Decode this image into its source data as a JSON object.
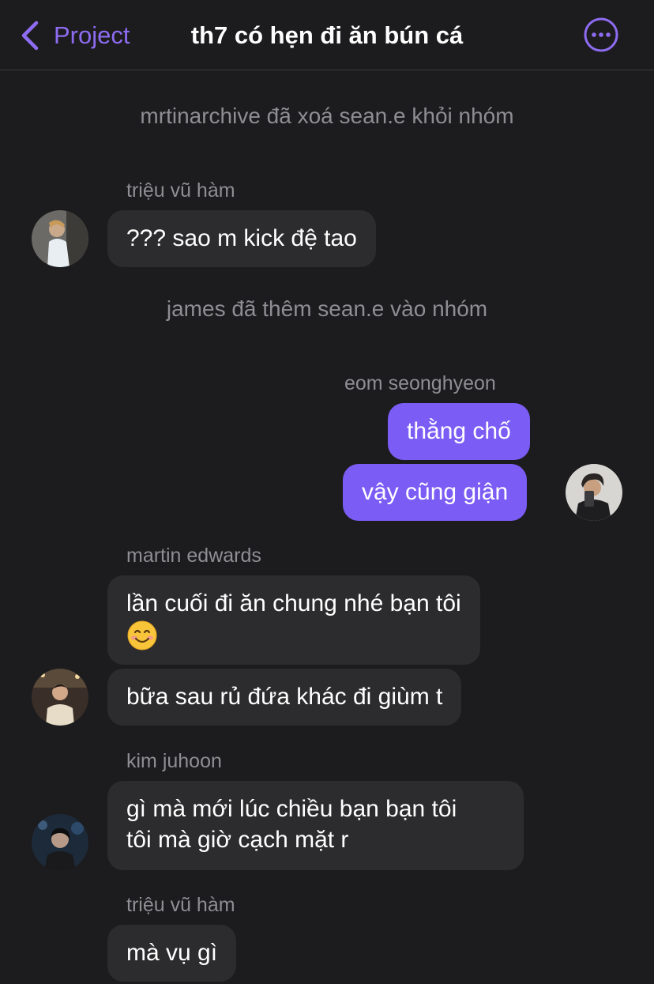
{
  "header": {
    "back_label": "Project",
    "title": "th7 có hẹn đi ăn bún cá",
    "back_icon": "chevron-left-icon",
    "more_icon": "ellipsis-circle-icon",
    "accent_color": "#8e6cf2"
  },
  "messages": {
    "system1": "mrtinarchive đã xoá sean.e khỏi nhóm",
    "sender1": "triệu vũ hàm",
    "msg1": "??? sao m kick đệ tao",
    "system2": "james đã thêm sean.e vào nhóm",
    "sender2": "eom seonghyeon",
    "msg2": "thằng chố",
    "msg3": "vậy cũng giận",
    "sender3": "martin edwards",
    "msg4_line1": "lần cuối đi ăn chung nhé bạn tôi",
    "msg4_emoji": "smiling-face-emoji",
    "msg5": "bữa sau rủ đứa khác đi giùm t",
    "sender4": "kim juhoon",
    "msg6_line1": "gì mà mới lúc chiều bạn bạn tôi",
    "msg6_line2": "tôi mà giờ cạch mặt r",
    "sender5": "triệu vũ hàm",
    "msg7": "mà vụ gì"
  },
  "colors": {
    "background": "#1c1c1e",
    "incoming_bubble": "#2c2c2e",
    "outgoing_bubble": "#7b5cf5",
    "meta_text": "#8e8e93"
  }
}
